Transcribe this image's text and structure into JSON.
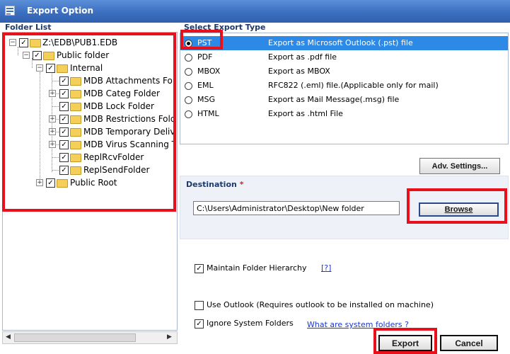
{
  "window": {
    "title": "Export Option"
  },
  "folder_list": {
    "heading": "Folder List",
    "nodes": [
      {
        "label": "Z:\\EDB\\PUB1.EDB",
        "checked": true
      },
      {
        "label": "Public folder",
        "checked": true
      },
      {
        "label": "Internal",
        "checked": true
      },
      {
        "label": "MDB Attachments Folde",
        "checked": true
      },
      {
        "label": "MDB Categ Folder",
        "checked": true
      },
      {
        "label": "MDB Lock Folder",
        "checked": true
      },
      {
        "label": "MDB Restrictions Folder",
        "checked": true
      },
      {
        "label": "MDB Temporary Deliver",
        "checked": true
      },
      {
        "label": "MDB Virus Scanning Ter",
        "checked": true
      },
      {
        "label": "ReplRcvFolder",
        "checked": true
      },
      {
        "label": "ReplSendFolder",
        "checked": true
      },
      {
        "label": "Public Root",
        "checked": true
      }
    ]
  },
  "export_type": {
    "heading": "Select Export Type",
    "options": [
      {
        "name": "PST",
        "desc": "Export as Microsoft Outlook (.pst) file",
        "selected": true
      },
      {
        "name": "PDF",
        "desc": "Export as .pdf file",
        "selected": false
      },
      {
        "name": "MBOX",
        "desc": "Export as MBOX",
        "selected": false
      },
      {
        "name": "EML",
        "desc": "RFC822 (.eml) file.(Applicable only for mail)",
        "selected": false
      },
      {
        "name": "MSG",
        "desc": "Export as Mail Message(.msg) file",
        "selected": false
      },
      {
        "name": "HTML",
        "desc": "Export as .html File",
        "selected": false
      }
    ]
  },
  "adv_settings_label": "Adv. Settings...",
  "destination": {
    "label": "Destination",
    "required_mark": "*",
    "path": "C:\\Users\\Administrator\\Desktop\\New folder",
    "browse_label": "Browse"
  },
  "options": {
    "maintain_hierarchy": {
      "label": "Maintain Folder Hierarchy",
      "checked": true
    },
    "help_link": "[?]",
    "use_outlook": {
      "label": "Use Outlook (Requires outlook to be installed on machine)",
      "checked": false
    },
    "ignore_system": {
      "label": "Ignore System Folders",
      "checked": true
    },
    "system_folders_link": "What are system folders ?"
  },
  "buttons": {
    "export": "Export",
    "cancel": "Cancel"
  },
  "colors": {
    "highlight": "#e8101a",
    "selection": "#2d89e6",
    "title_bar": "#3c6fc0"
  },
  "icons": {
    "app": "export-app-icon",
    "folder": "folder-icon",
    "check": "✓"
  }
}
